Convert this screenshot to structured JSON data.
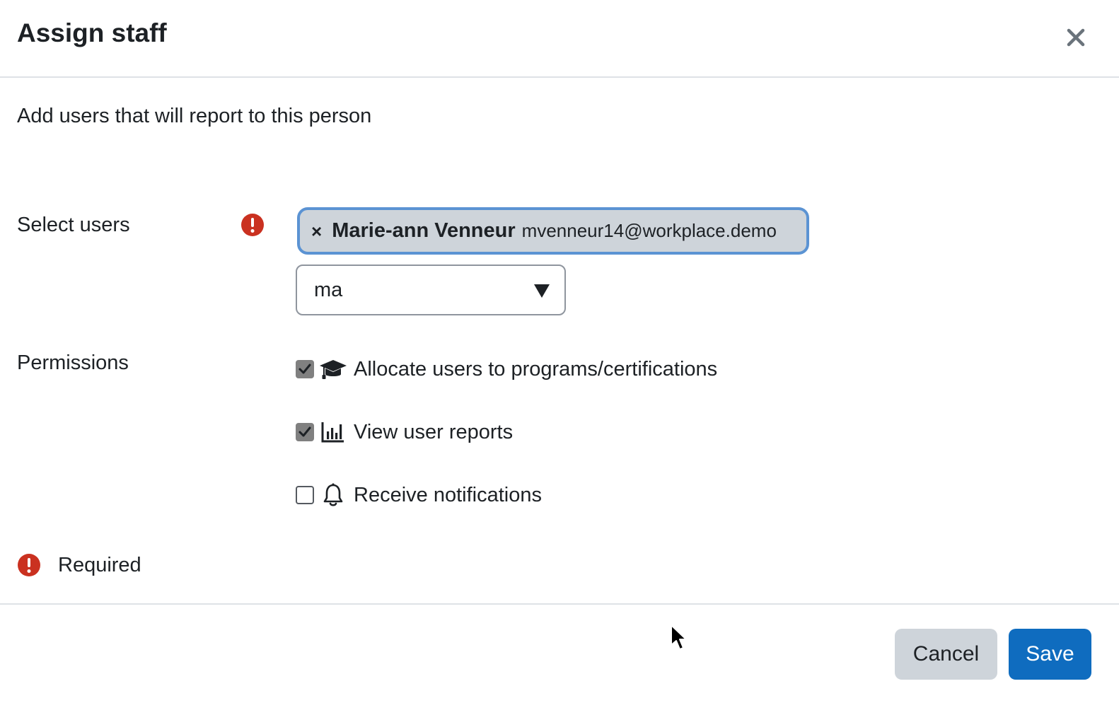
{
  "dialog": {
    "title": "Assign staff",
    "description": "Add users that will report to this person"
  },
  "select_users": {
    "label": "Select users",
    "selected": [
      {
        "remove_glyph": "×",
        "name": "Marie-ann Venneur",
        "email": "mvenneur14@workplace.demo"
      }
    ],
    "search_value": "ma"
  },
  "permissions": {
    "label": "Permissions",
    "items": [
      {
        "label": "Allocate users to programs/certifications",
        "checked": true,
        "icon": "graduation-cap-icon"
      },
      {
        "label": "View user reports",
        "checked": true,
        "icon": "bar-chart-icon"
      },
      {
        "label": "Receive notifications",
        "checked": false,
        "icon": "bell-icon"
      }
    ]
  },
  "required_note": "Required",
  "footer": {
    "cancel_label": "Cancel",
    "save_label": "Save"
  },
  "colors": {
    "primary": "#0f6cbf",
    "required": "#ca3120",
    "chip_border": "#5b93d3"
  }
}
